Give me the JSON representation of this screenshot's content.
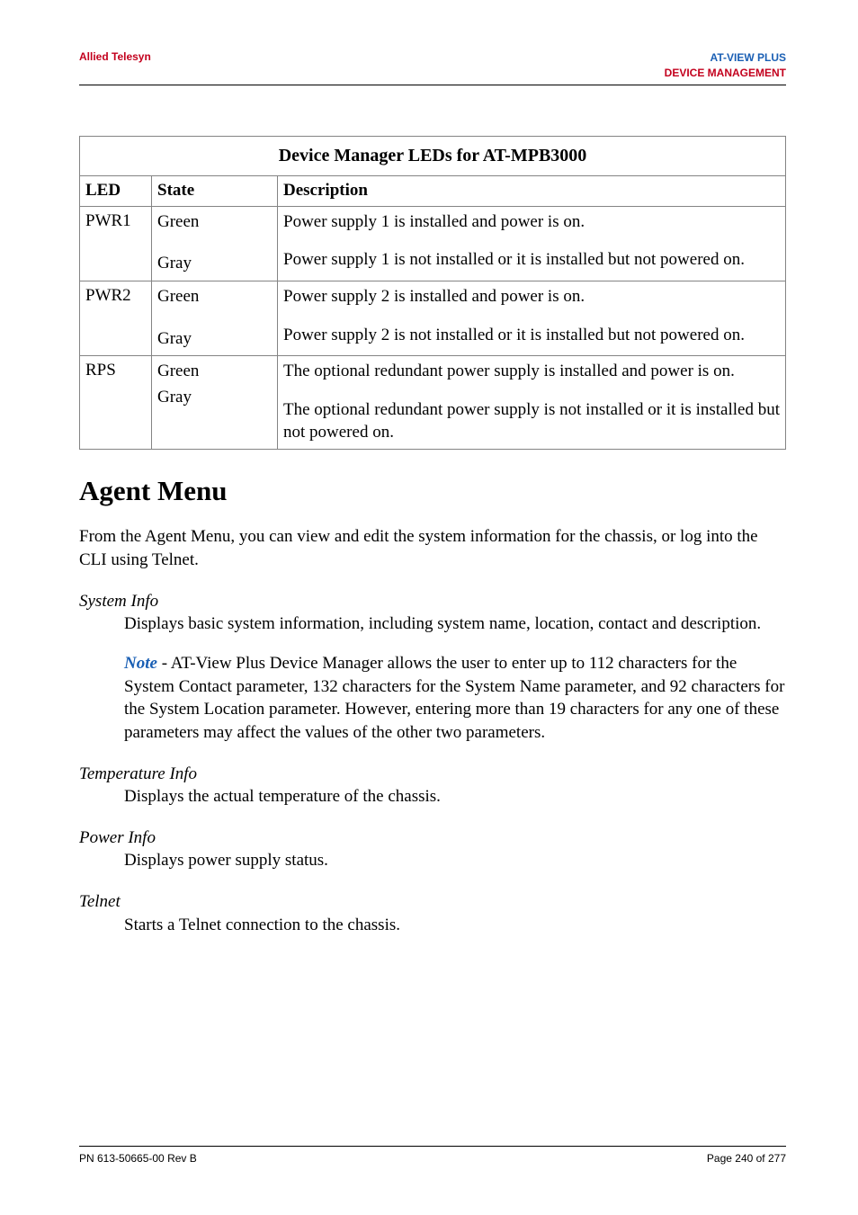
{
  "header": {
    "left": "Allied Telesyn",
    "right1": "AT-VIEW PLUS",
    "right2": "DEVICE MANAGEMENT"
  },
  "table": {
    "caption": "Device Manager LEDs for AT-MPB3000",
    "head": {
      "led": "LED",
      "state": "State",
      "desc": "Description"
    },
    "rows": [
      {
        "led": "PWR1",
        "state1": "Green",
        "state2": "Gray",
        "desc1": "Power supply 1 is installed and power is on.",
        "desc2": "Power supply 1 is not installed or it is installed but not powered on."
      },
      {
        "led": "PWR2",
        "state1": "Green",
        "state2": "Gray",
        "desc1": "Power supply 2 is installed and power is on.",
        "desc2": "Power supply 2 is not installed or it is installed but not powered on."
      },
      {
        "led": "RPS",
        "state1": "Green",
        "state2": "Gray",
        "desc1": "The optional redundant power supply is installed and power is on.",
        "desc2": "The optional redundant power supply is not installed or it is installed but not powered on."
      }
    ]
  },
  "h1": "Agent Menu",
  "intro": "From the Agent Menu, you can view and edit the system information for the chassis, or log into the CLI using Telnet.",
  "sysinfo": {
    "term": "System Info",
    "def": "Displays basic system information, including system name, location, contact and description.",
    "noteLabel": "Note",
    "noteRest": " - AT-View Plus Device Manager allows the user to enter up to 112 characters for the System Contact parameter, 132 characters for the System Name parameter, and 92 characters for the System Location parameter. However, entering more than 19 characters for any one of these parameters may affect the values of the other two parameters."
  },
  "temp": {
    "term": "Temperature Info",
    "def": "Displays the actual temperature of the chassis."
  },
  "power": {
    "term": "Power Info",
    "def": "Displays power supply status."
  },
  "telnet": {
    "term": "Telnet",
    "def": "Starts a Telnet connection to the chassis."
  },
  "footer": {
    "left": "PN 613-50665-00 Rev B",
    "right": "Page 240 of 277"
  }
}
